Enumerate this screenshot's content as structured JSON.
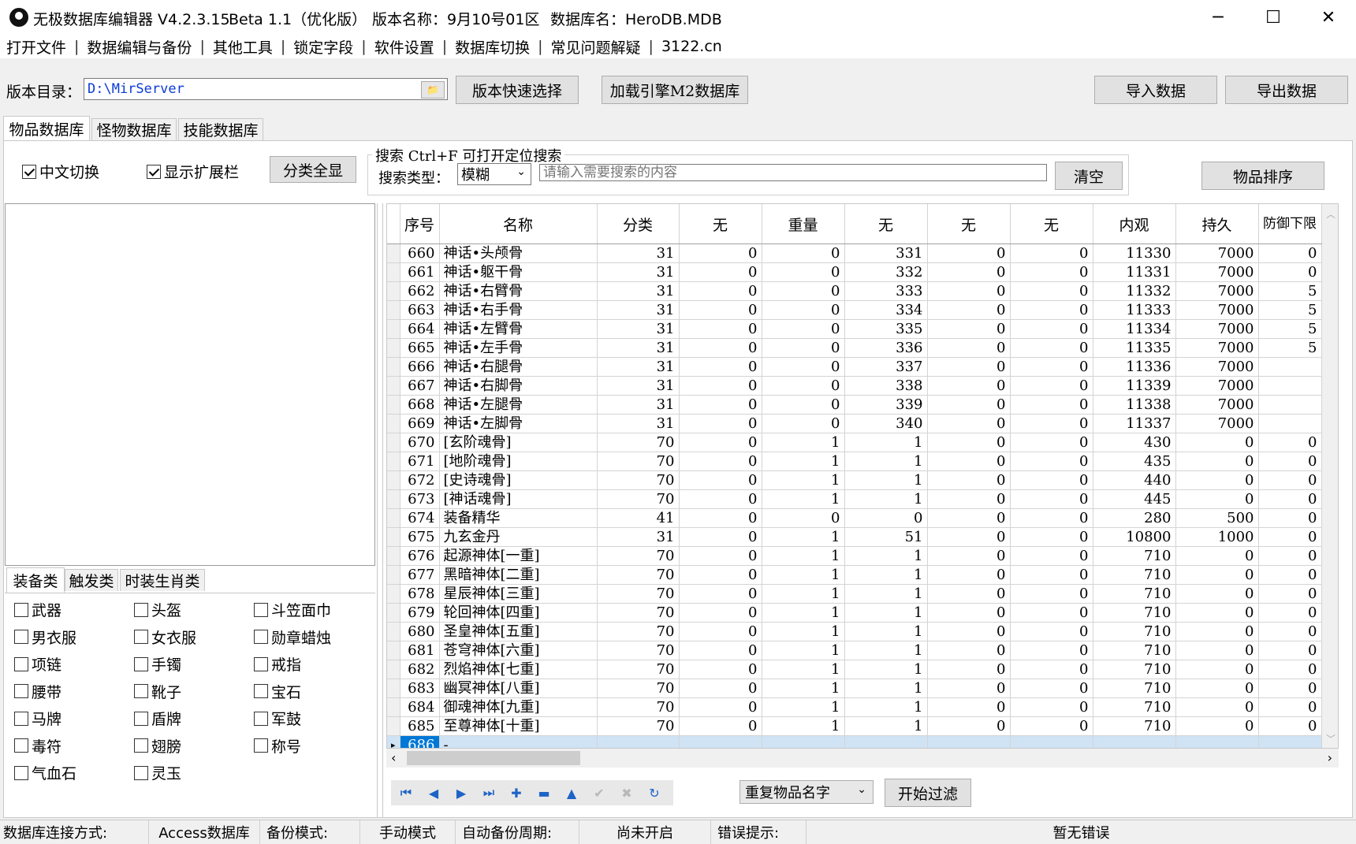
{
  "window": {
    "app_title": "无极数据库编辑器 V4.2.3.15",
    "beta": "Beta 1.1（优化版）",
    "version_name": "版本名称：9月10号01区",
    "db_name": "数据库名：HeroDB.MDB",
    "minimize": "─",
    "maximize": "☐",
    "close": "✕"
  },
  "menu": [
    "打开文件",
    "数据编辑与备份",
    "其他工具",
    "锁定字段",
    "软件设置",
    "数据库切换",
    "常见问题解疑",
    "3122.cn"
  ],
  "toolbar": {
    "dir_label": "版本目录：",
    "dir_value": "D:\\MirServer",
    "quick_select": "版本快速选择",
    "load_m2": "加载引擎M2数据库",
    "import": "导入数据",
    "export": "导出数据"
  },
  "tabs": [
    "物品数据库",
    "怪物数据库",
    "技能数据库"
  ],
  "options": {
    "chinese_switch": "中文切换",
    "show_ext": "显示扩展栏",
    "show_all": "分类全显",
    "search_title": "搜索  Ctrl+F 可打开定位搜索",
    "search_type_label": "搜索类型：",
    "search_type_value": "模糊",
    "search_placeholder": "请输入需要搜索的内容",
    "clear": "清空",
    "sort": "物品排序"
  },
  "category_tabs": [
    "装备类",
    "触发类",
    "时装生肖类"
  ],
  "categories": [
    [
      "武器",
      "头盔",
      "斗笠面巾"
    ],
    [
      "男衣服",
      "女衣服",
      "勋章蜡烛"
    ],
    [
      "项链",
      "手镯",
      "戒指"
    ],
    [
      "腰带",
      "靴子",
      "宝石"
    ],
    [
      "马牌",
      "盾牌",
      "军鼓"
    ],
    [
      "毒符",
      "翅膀",
      "称号"
    ],
    [
      "气血石",
      "灵玉",
      ""
    ]
  ],
  "grid": {
    "columns": [
      "序号",
      "名称",
      "分类",
      "无",
      "重量",
      "无",
      "无",
      "无",
      "内观",
      "持久",
      "防御下限"
    ],
    "rows": [
      [
        "660",
        "神话•头颅骨",
        "31",
        "0",
        "0",
        "331",
        "0",
        "0",
        "11330",
        "7000",
        "0"
      ],
      [
        "661",
        "神话•躯干骨",
        "31",
        "0",
        "0",
        "332",
        "0",
        "0",
        "11331",
        "7000",
        "0"
      ],
      [
        "662",
        "神话•右臂骨",
        "31",
        "0",
        "0",
        "333",
        "0",
        "0",
        "11332",
        "7000",
        "5"
      ],
      [
        "663",
        "神话•右手骨",
        "31",
        "0",
        "0",
        "334",
        "0",
        "0",
        "11333",
        "7000",
        "5"
      ],
      [
        "664",
        "神话•左臂骨",
        "31",
        "0",
        "0",
        "335",
        "0",
        "0",
        "11334",
        "7000",
        "5"
      ],
      [
        "665",
        "神话•左手骨",
        "31",
        "0",
        "0",
        "336",
        "0",
        "0",
        "11335",
        "7000",
        "5"
      ],
      [
        "666",
        "神话•右腿骨",
        "31",
        "0",
        "0",
        "337",
        "0",
        "0",
        "11336",
        "7000",
        ""
      ],
      [
        "667",
        "神话•右脚骨",
        "31",
        "0",
        "0",
        "338",
        "0",
        "0",
        "11339",
        "7000",
        ""
      ],
      [
        "668",
        "神话•左腿骨",
        "31",
        "0",
        "0",
        "339",
        "0",
        "0",
        "11338",
        "7000",
        ""
      ],
      [
        "669",
        "神话•左脚骨",
        "31",
        "0",
        "0",
        "340",
        "0",
        "0",
        "11337",
        "7000",
        ""
      ],
      [
        "670",
        "[玄阶魂骨]",
        "70",
        "0",
        "1",
        "1",
        "0",
        "0",
        "430",
        "0",
        "0"
      ],
      [
        "671",
        "[地阶魂骨]",
        "70",
        "0",
        "1",
        "1",
        "0",
        "0",
        "435",
        "0",
        "0"
      ],
      [
        "672",
        "[史诗魂骨]",
        "70",
        "0",
        "1",
        "1",
        "0",
        "0",
        "440",
        "0",
        "0"
      ],
      [
        "673",
        "[神话魂骨]",
        "70",
        "0",
        "1",
        "1",
        "0",
        "0",
        "445",
        "0",
        "0"
      ],
      [
        "674",
        "装备精华",
        "41",
        "0",
        "0",
        "0",
        "0",
        "0",
        "280",
        "500",
        "0"
      ],
      [
        "675",
        "九玄金丹",
        "31",
        "0",
        "1",
        "51",
        "0",
        "0",
        "10800",
        "1000",
        "0"
      ],
      [
        "676",
        "起源神体[一重]",
        "70",
        "0",
        "1",
        "1",
        "0",
        "0",
        "710",
        "0",
        "0"
      ],
      [
        "677",
        "黑暗神体[二重]",
        "70",
        "0",
        "1",
        "1",
        "0",
        "0",
        "710",
        "0",
        "0"
      ],
      [
        "678",
        "星辰神体[三重]",
        "70",
        "0",
        "1",
        "1",
        "0",
        "0",
        "710",
        "0",
        "0"
      ],
      [
        "679",
        "轮回神体[四重]",
        "70",
        "0",
        "1",
        "1",
        "0",
        "0",
        "710",
        "0",
        "0"
      ],
      [
        "680",
        "圣皇神体[五重]",
        "70",
        "0",
        "1",
        "1",
        "0",
        "0",
        "710",
        "0",
        "0"
      ],
      [
        "681",
        "苍穹神体[六重]",
        "70",
        "0",
        "1",
        "1",
        "0",
        "0",
        "710",
        "0",
        "0"
      ],
      [
        "682",
        "烈焰神体[七重]",
        "70",
        "0",
        "1",
        "1",
        "0",
        "0",
        "710",
        "0",
        "0"
      ],
      [
        "683",
        "幽冥神体[八重]",
        "70",
        "0",
        "1",
        "1",
        "0",
        "0",
        "710",
        "0",
        "0"
      ],
      [
        "684",
        "御魂神体[九重]",
        "70",
        "0",
        "1",
        "1",
        "0",
        "0",
        "710",
        "0",
        "0"
      ],
      [
        "685",
        "至尊神体[十重]",
        "70",
        "0",
        "1",
        "1",
        "0",
        "0",
        "710",
        "0",
        "0"
      ]
    ],
    "new_row": {
      "id": "686",
      "name": "-"
    }
  },
  "bottom": {
    "filter_select": "重复物品名字",
    "filter_button": "开始过滤"
  },
  "status": {
    "conn_label": "数据库连接方式:",
    "conn_value": "Access数据库",
    "backup_label": "备份模式:",
    "backup_value": "手动模式",
    "auto_label": "自动备份周期:",
    "auto_value": "尚未开启",
    "error_label": "错误提示:",
    "error_value": "暂无错误"
  }
}
